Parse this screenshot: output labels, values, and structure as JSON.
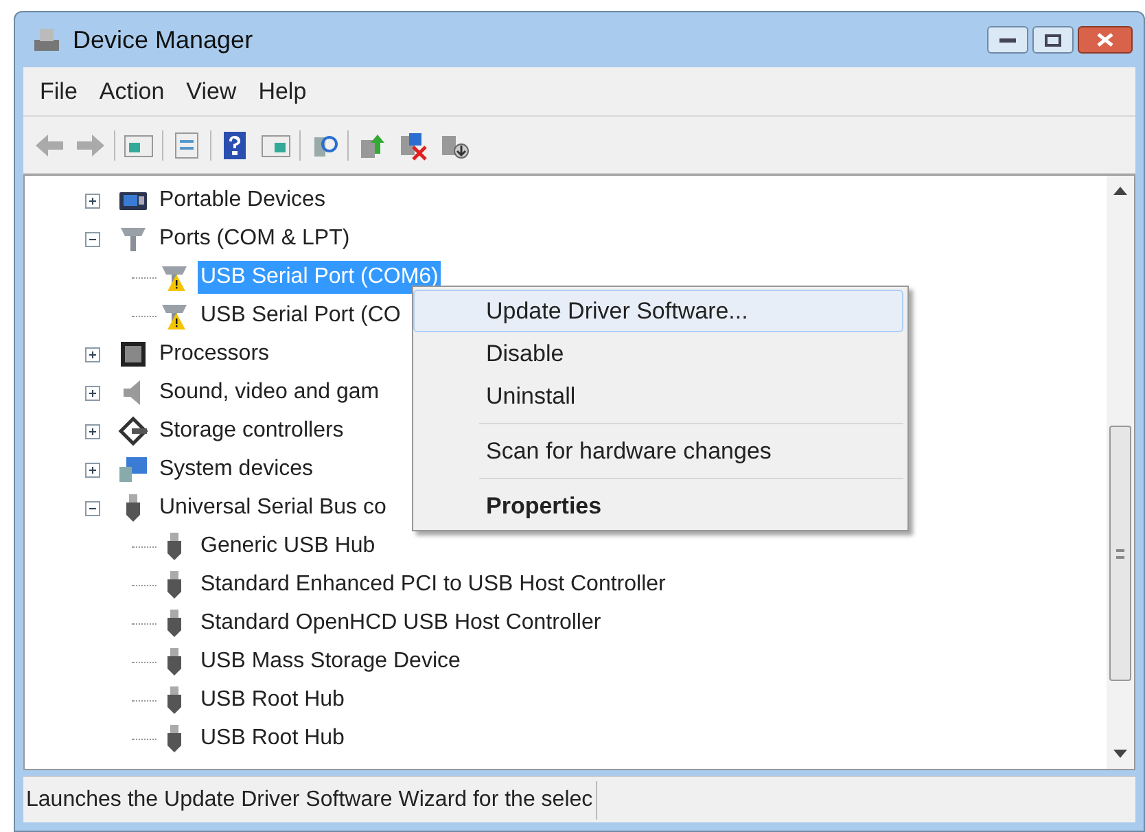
{
  "window": {
    "title": "Device Manager"
  },
  "menu_bar": [
    "File",
    "Action",
    "View",
    "Help"
  ],
  "tree": [
    {
      "label": "Portable Devices",
      "kind": "portable",
      "expanded": false,
      "selected": false
    },
    {
      "label": "Ports (COM & LPT)",
      "kind": "port",
      "expanded": true,
      "selected": false,
      "children": [
        {
          "label": "USB Serial Port (COM6)",
          "kind": "port",
          "warning": true,
          "selected": true
        },
        {
          "label": "USB Serial Port (CO",
          "kind": "port",
          "warning": true,
          "selected": false
        }
      ]
    },
    {
      "label": "Processors",
      "kind": "processor",
      "expanded": false,
      "selected": false
    },
    {
      "label": "Sound, video and gam",
      "kind": "sound",
      "expanded": false,
      "selected": false
    },
    {
      "label": "Storage controllers",
      "kind": "storage",
      "expanded": false,
      "selected": false
    },
    {
      "label": "System devices",
      "kind": "system",
      "expanded": false,
      "selected": false
    },
    {
      "label": "Universal Serial Bus co",
      "kind": "usb",
      "expanded": true,
      "selected": false,
      "children": [
        {
          "label": "Generic USB Hub",
          "kind": "usb",
          "warning": false,
          "selected": false
        },
        {
          "label": "Standard Enhanced PCI to USB Host Controller",
          "kind": "usb",
          "warning": false,
          "selected": false
        },
        {
          "label": "Standard OpenHCD USB Host Controller",
          "kind": "usb",
          "warning": false,
          "selected": false
        },
        {
          "label": "USB Mass Storage Device",
          "kind": "usb",
          "warning": false,
          "selected": false
        },
        {
          "label": "USB Root Hub",
          "kind": "usb",
          "warning": false,
          "selected": false
        },
        {
          "label": "USB Root Hub",
          "kind": "usb",
          "warning": false,
          "selected": false
        }
      ]
    }
  ],
  "context_menu": {
    "groups": [
      [
        {
          "label": "Update Driver Software...",
          "selected": true,
          "default": false
        },
        {
          "label": "Disable",
          "selected": false,
          "default": false
        },
        {
          "label": "Uninstall",
          "selected": false,
          "default": false
        }
      ],
      [
        {
          "label": "Scan for hardware changes",
          "selected": false,
          "default": false
        }
      ],
      [
        {
          "label": "Properties",
          "selected": false,
          "default": true
        }
      ]
    ]
  },
  "status_bar": "Launches the Update Driver Software Wizard for the selec"
}
